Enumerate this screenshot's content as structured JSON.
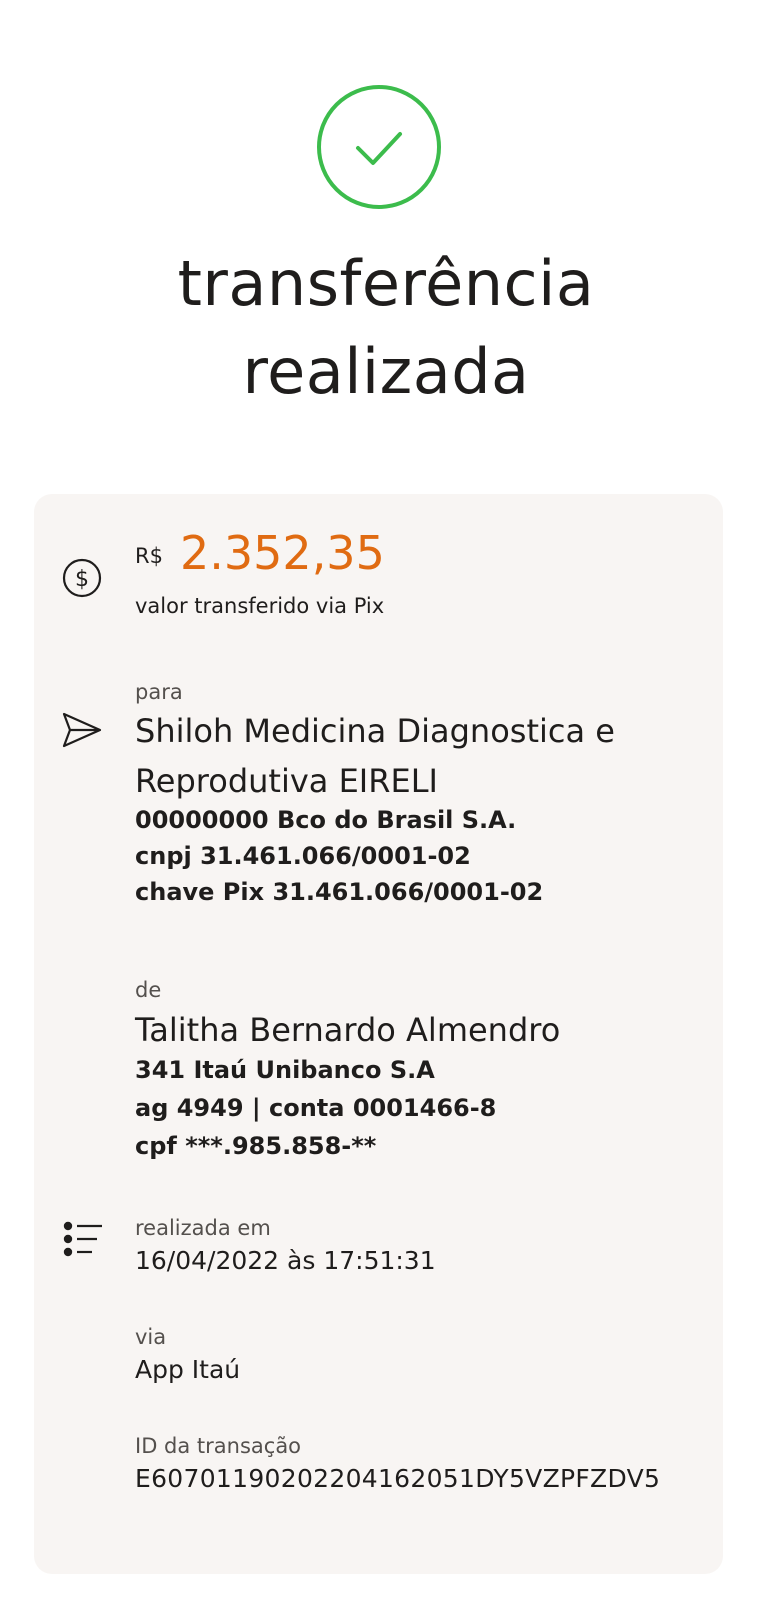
{
  "header": {
    "title_line1": "transferência",
    "title_line2": "realizada",
    "success_color": "#3cbc4c"
  },
  "amount": {
    "currency": "R$",
    "value": "2.352,35",
    "description": "valor transferido via Pix",
    "icon": "dollar-circle-icon",
    "accent_color": "#e06b12"
  },
  "recipient": {
    "label": "para",
    "icon": "send-icon",
    "name_line1": "Shiloh Medicina Diagnostica e",
    "name_line2": "Reprodutiva EIRELI",
    "bank": "00000000 Bco do Brasil S.A.",
    "cnpj": "cnpj 31.461.066/0001-02",
    "pix_key": "chave Pix 31.461.066/0001-02"
  },
  "sender": {
    "label": "de",
    "name": "Talitha Bernardo Almendro",
    "bank": "341 Itaú Unibanco S.A",
    "account": "ag 4949 | conta 0001466-8",
    "cpf": "cpf ***.985.858-**"
  },
  "details": {
    "icon": "list-icon",
    "date_label": "realizada em",
    "date_value": "16/04/2022 às 17:51:31",
    "via_label": "via",
    "via_value": "App Itaú",
    "id_label": "ID da transação",
    "id_value": "E60701190202204162051DY5VZPFZDV5"
  }
}
